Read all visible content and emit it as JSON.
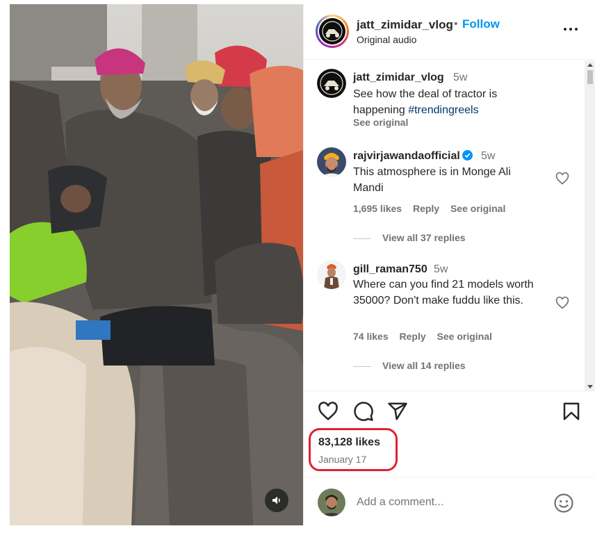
{
  "post": {
    "username": "jatt_zimidar_vlog",
    "separator": "•",
    "follow_label": "Follow",
    "audio_label": "Original audio"
  },
  "caption": {
    "username": "jatt_zimidar_vlog",
    "time": "5w",
    "text": "See how the deal of tractor is happening ",
    "hashtag": "#trendingreels",
    "see_original": "See original"
  },
  "comments": [
    {
      "username": "rajvirjawandaofficial",
      "verified": true,
      "time": "5w",
      "text": "This atmosphere is in Monge Ali Mandi",
      "likes": "1,695 likes",
      "reply_label": "Reply",
      "see_original": "See original",
      "view_replies": "View all 37 replies"
    },
    {
      "username": "gill_raman750",
      "verified": false,
      "time": "5w",
      "text": "Where can you find 21 models worth 35000? Don't make fuddu like this.",
      "likes": "74 likes",
      "reply_label": "Reply",
      "see_original": "See original",
      "view_replies": "View all 14 replies"
    }
  ],
  "actions": {
    "like_icon": "heart-icon",
    "comment_icon": "comment-bubble-icon",
    "share_icon": "paper-plane-icon",
    "save_icon": "bookmark-icon",
    "likes_count": "83,128 likes",
    "date": "January 17"
  },
  "add_comment": {
    "placeholder": "Add a comment...",
    "emoji_icon": "smiley-icon"
  },
  "media": {
    "mute_icon": "speaker-icon"
  },
  "colors": {
    "follow_blue": "#0095f6",
    "hashtag_blue": "#00376b",
    "muted_text": "#737373",
    "highlight_red": "#e0212e"
  }
}
